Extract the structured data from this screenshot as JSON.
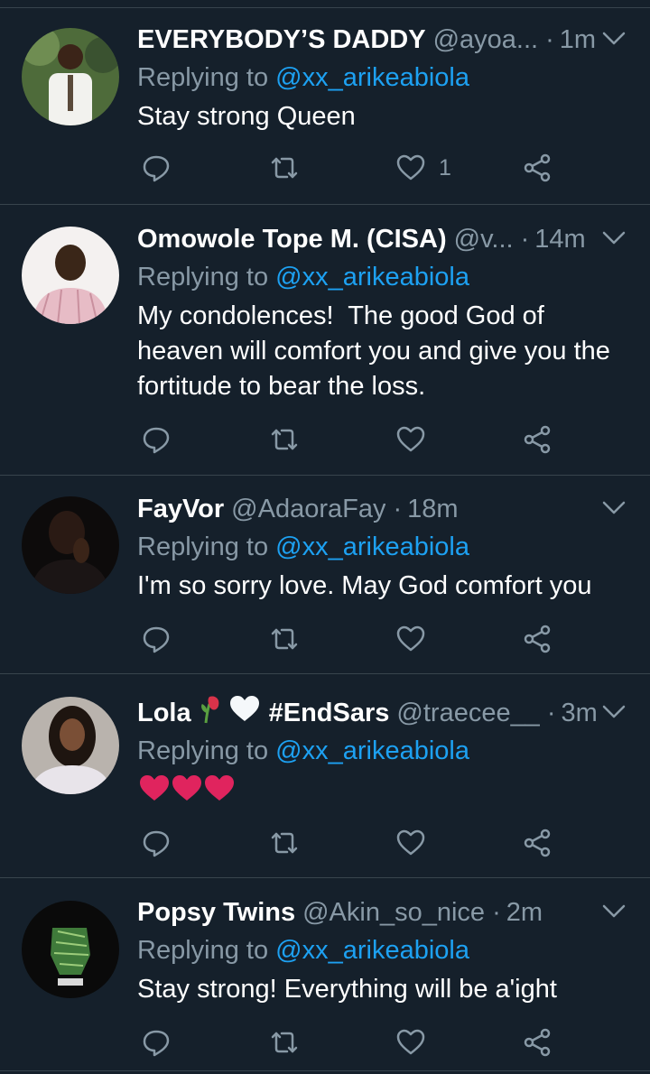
{
  "colors": {
    "background": "#15202b",
    "text": "#ffffff",
    "muted": "#8899a6",
    "link": "#1da1f2",
    "divider": "#38444d",
    "heart": "#e0245e"
  },
  "tweets": [
    {
      "name": "EVERYBODY’S DADDY",
      "handle": "@ayoa...",
      "time": "1m",
      "reply_prefix": "Replying to",
      "reply_to": "@xx_arikeabiola",
      "text": "Stay strong Queen",
      "like_count": "1"
    },
    {
      "name": "Omowole Tope M. (CISA)",
      "handle": "@v...",
      "time": "14m",
      "reply_prefix": "Replying to",
      "reply_to": "@xx_arikeabiola",
      "text": "My condolences!  The good God of heaven will comfort you and give you the fortitude to bear the loss.",
      "like_count": ""
    },
    {
      "name": "FayVor",
      "handle": "@AdaoraFay",
      "time": "18m",
      "reply_prefix": "Replying to",
      "reply_to": "@xx_arikeabiola",
      "text": "I'm so sorry love. May God comfort you",
      "like_count": ""
    },
    {
      "name": "Lola",
      "name_suffix": "#EndSars",
      "handle": "@traecee__",
      "time": "3m",
      "reply_prefix": "Replying to",
      "reply_to": "@xx_arikeabiola",
      "text": "",
      "emojis": [
        "red-heart",
        "red-heart",
        "red-heart"
      ],
      "like_count": ""
    },
    {
      "name": "Popsy Twins",
      "handle": "@Akin_so_nice",
      "time": "2m",
      "reply_prefix": "Replying to",
      "reply_to": "@xx_arikeabiola",
      "text": "Stay strong! Everything will be a'ight",
      "like_count": ""
    }
  ],
  "icons": {
    "reply": "reply-icon",
    "retweet": "retweet-icon",
    "like": "heart-icon",
    "share": "share-icon",
    "more": "chevron-down-icon"
  }
}
